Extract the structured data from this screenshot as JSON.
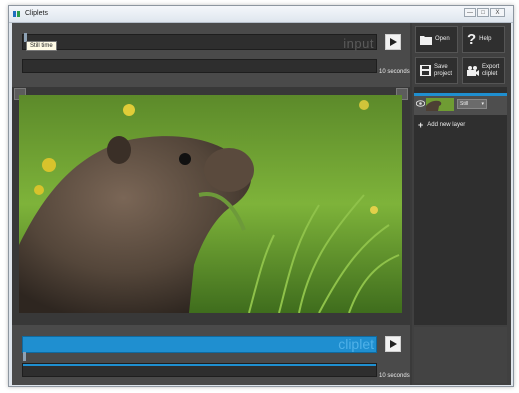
{
  "window": {
    "title": "Cliplets",
    "controls": {
      "minimize": "—",
      "maximize": "□",
      "close": "X"
    }
  },
  "input_panel": {
    "track_label": "input",
    "tooltip": "Still time",
    "duration_label": "10 seconds"
  },
  "output_panel": {
    "track_label": "cliplet",
    "duration_label": "10 seconds"
  },
  "toolbar": {
    "open_label": "Open",
    "help_label": "Help",
    "save_label": "Save project",
    "export_label": "Export cliplet"
  },
  "layers": {
    "items": [
      {
        "mode": "Still"
      }
    ],
    "add_label": "Add new layer"
  },
  "colors": {
    "accent": "#1f8fd0",
    "panel": "#4a4a4a",
    "background": "#3a3a3a"
  }
}
